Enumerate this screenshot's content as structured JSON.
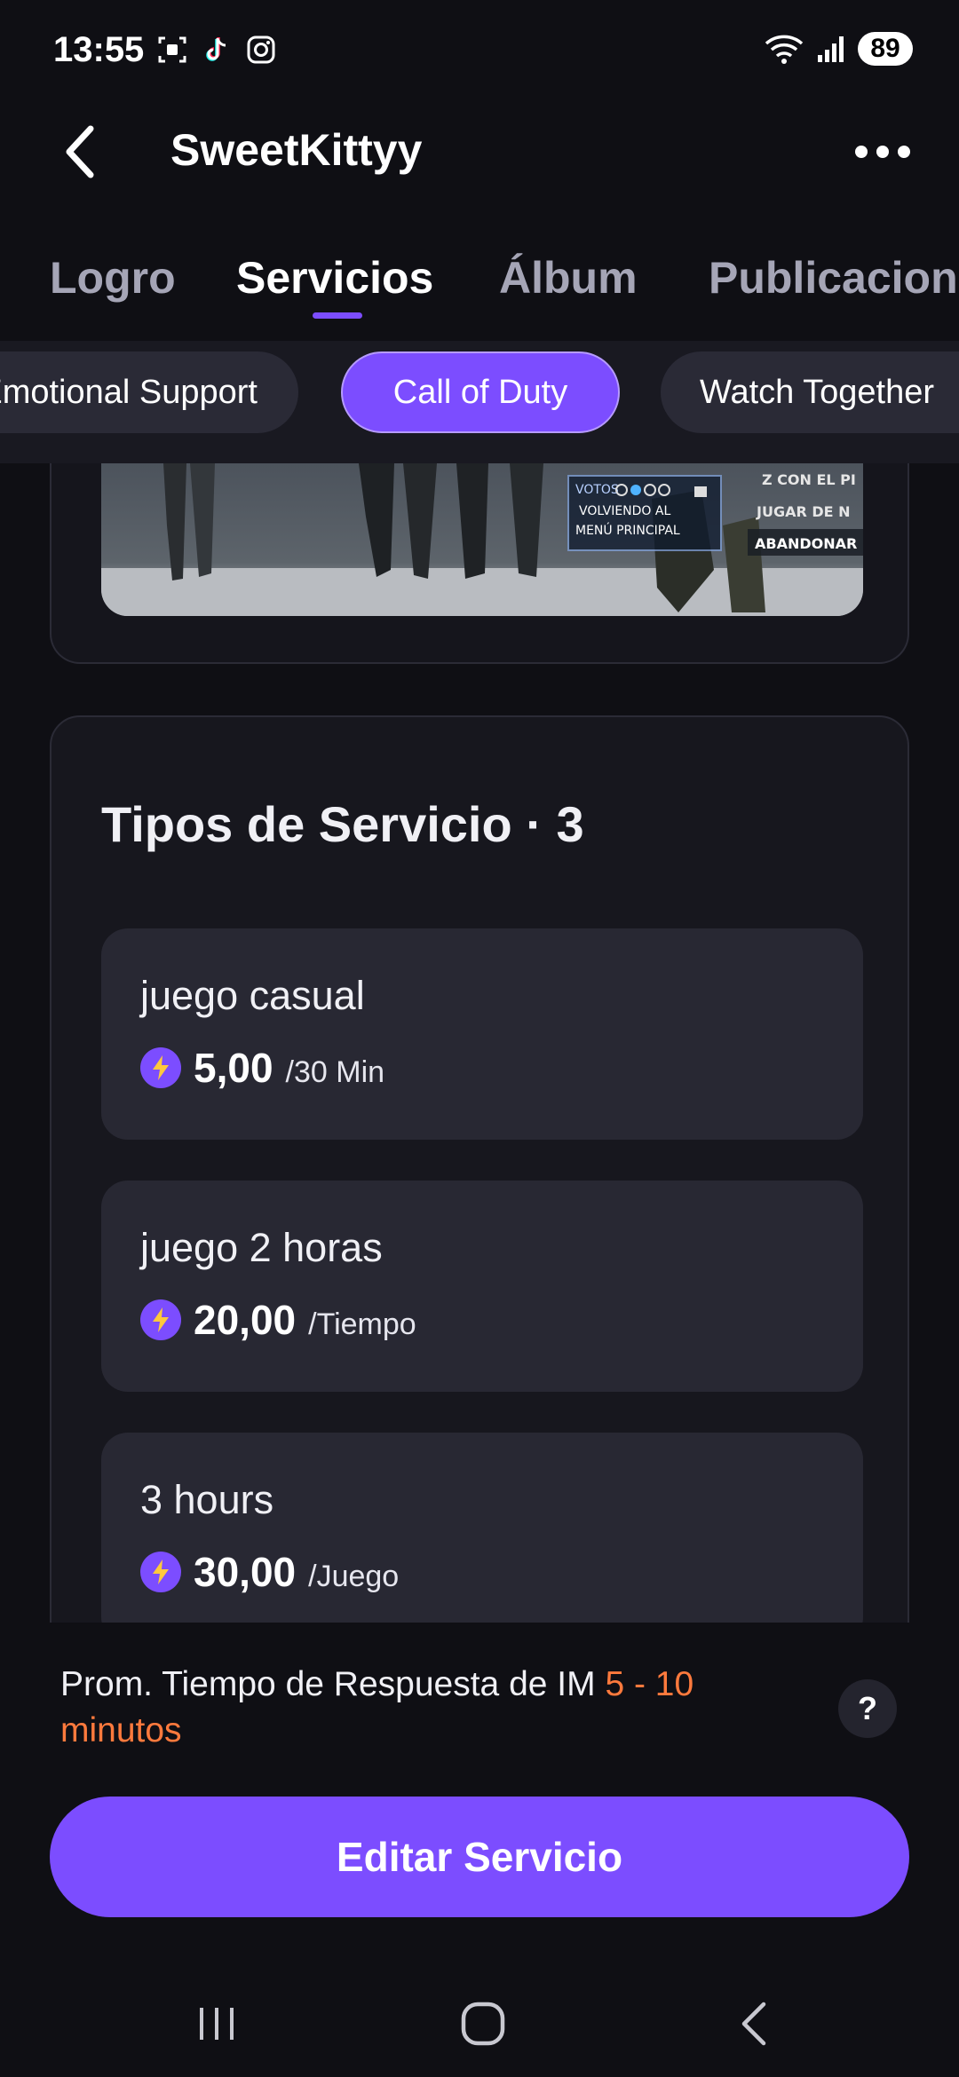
{
  "status_bar": {
    "time": "13:55",
    "battery": "89",
    "notification_icons": [
      "screenshot-icon",
      "tiktok-icon",
      "instagram-icon"
    ]
  },
  "header": {
    "title": "SweetKittyy"
  },
  "tabs": [
    {
      "label": "Logro",
      "active": false
    },
    {
      "label": "Servicios",
      "active": true
    },
    {
      "label": "Álbum",
      "active": false
    },
    {
      "label": "Publicaciones",
      "active": false
    }
  ],
  "chips": [
    {
      "label": "Emotional Support",
      "active": false
    },
    {
      "label": "Call of Duty",
      "active": true
    },
    {
      "label": "Watch Together",
      "active": false
    }
  ],
  "media": {
    "overlay_lines": [
      "VOTOS",
      "VOLVIENDO AL",
      "MENÚ PRINCIPAL"
    ],
    "side_lines": [
      "Z CON EL PI",
      "JUGAR DE N",
      "ABANDONAR"
    ]
  },
  "services": {
    "title": "Tipos de Servicio · 3",
    "items": [
      {
        "name": "juego casual",
        "price": "5,00",
        "unit": "/30 Min"
      },
      {
        "name": "juego 2 horas",
        "price": "20,00",
        "unit": "/Tiempo"
      },
      {
        "name": "3 hours",
        "price": "30,00",
        "unit": "/Juego"
      }
    ]
  },
  "response": {
    "label": "Prom. Tiempo de Respuesta de IM ",
    "value": "5 - 10 minutos",
    "help": "?"
  },
  "actions": {
    "edit_label": "Editar Servicio"
  },
  "colors": {
    "accent": "#7c4dff",
    "highlight": "#ff7a3d",
    "background": "#0f0f14",
    "card": "#282833"
  }
}
